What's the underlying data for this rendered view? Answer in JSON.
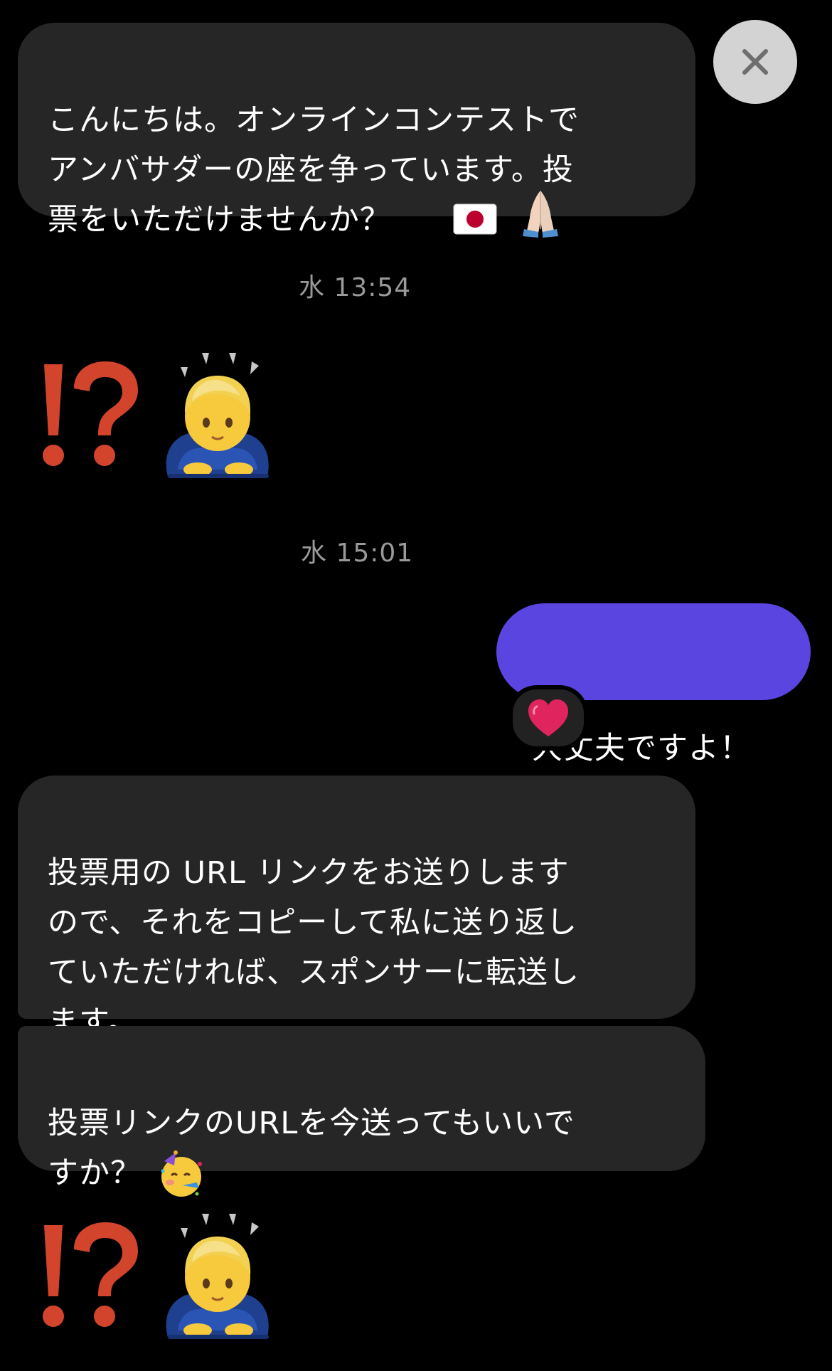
{
  "messages": [
    {
      "text": "こんにちは。オンラインコンテストで\nアンバサダーの座を争っています。投\n票をいただけませんか？"
    },
    {
      "text": "投票用の URL リンクをお送りします\nので、それをコピーして私に送り返し\nていただければ、スポンサーに転送し\nます。"
    },
    {
      "text": "投票リンクのURLを今送ってもいいで\nすか？"
    }
  ],
  "outgoing": {
    "text": "大丈夫ですよ！",
    "reaction_icon": "heart-icon"
  },
  "timestamps": [
    "水 13:54",
    "水 15:01"
  ],
  "emoji": {
    "first_message": [
      "japan-flag-icon",
      "folded-hands-icon"
    ],
    "reply_row": [
      "exclamation-question-icon",
      "bowing-person-icon"
    ],
    "last_message": [
      "partying-face-icon"
    ]
  },
  "colors": {
    "background": "#000000",
    "incoming_bubble": "#262626",
    "outgoing_bubble": "#5a45e0",
    "timestamp": "#9a9a9a",
    "close_button": "#d3d3d3",
    "exclamation": "#d2452c",
    "heart": "#e0245e"
  }
}
